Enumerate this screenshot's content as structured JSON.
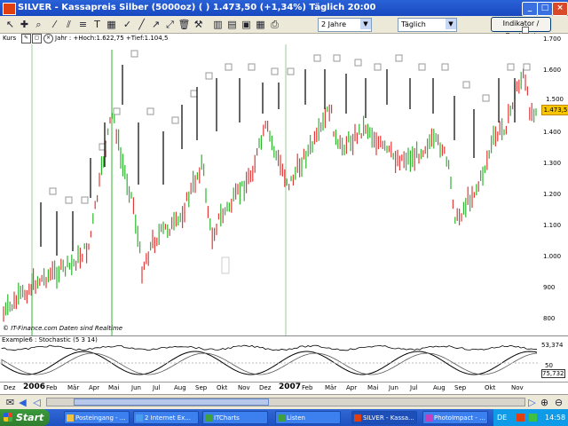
{
  "window": {
    "title": "SILVER - Kassapreis Silber (5000oz) ( )   1.473,50 (+1,34%)   Täglich  20:00"
  },
  "toolbar": {
    "period_select": "2 Jahre",
    "interval_select": "Täglich",
    "indicator_button": "Indikator / Backtest"
  },
  "chart_header": {
    "panel_label": "Kurs",
    "range_text": "Jahr : +Hoch:1.622,75 +Tief:1.104,5"
  },
  "price_axis": {
    "ticks": [
      "1.700",
      "1.600",
      "1.500",
      "1.400",
      "1.300",
      "1.200",
      "1.100",
      "1.000",
      "900",
      "800"
    ],
    "current_badge": "1.473,5",
    "last_badge": "1.500"
  },
  "watermark": "© IT-Finance.com  Daten sind Realtime",
  "indicator": {
    "label": "Example6 : Stochastic (5 3 14)",
    "value_top": "53,374",
    "value_mid": "50",
    "value_bottom": "75,732"
  },
  "x_axis": {
    "labels": [
      "Dez",
      "2006",
      "Feb",
      "Mär",
      "Apr",
      "Mai",
      "Jun",
      "Jul",
      "Aug",
      "Sep",
      "Okt",
      "Nov",
      "Dez",
      "2007",
      "Feb",
      "Mär",
      "Apr",
      "Mai",
      "Jun",
      "Jul",
      "Aug",
      "Sep",
      "Okt",
      "Nov"
    ]
  },
  "taskbar": {
    "start": "Start",
    "tasks": [
      "Posteingang - ...",
      "2 Internet Ex...",
      "ITCharts",
      "Listen",
      "SILVER - Kassa...",
      "PhotoImpact - ..."
    ],
    "lang": "DE",
    "clock": "14:58"
  },
  "colors": {
    "up_candle": "#2db52d",
    "down_candle": "#e03b3b",
    "accent": "#2a62d8"
  }
}
